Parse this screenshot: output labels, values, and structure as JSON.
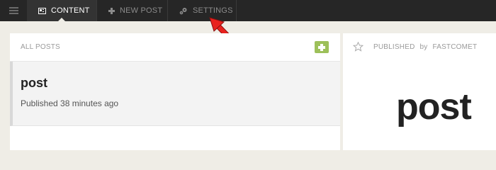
{
  "topbar": {
    "tabs": [
      {
        "label": "CONTENT",
        "icon": "content-icon",
        "active": true
      },
      {
        "label": "NEW POST",
        "icon": "plus-icon",
        "active": false
      },
      {
        "label": "SETTINGS",
        "icon": "gears-icon",
        "active": false
      }
    ]
  },
  "posts_panel": {
    "title": "ALL POSTS",
    "add_icon": "plus-icon",
    "posts": [
      {
        "title": "post",
        "meta": "Published 38 minutes ago"
      }
    ]
  },
  "preview": {
    "status": "PUBLISHED",
    "by": "by",
    "author": "FASTCOMET",
    "title": "post"
  },
  "colors": {
    "topbar_bg": "#262626",
    "active_tab_bg": "#333333",
    "add_button": "#9dc05a",
    "pointer_arrow": "#e8221e",
    "page_bg": "#efede6"
  }
}
